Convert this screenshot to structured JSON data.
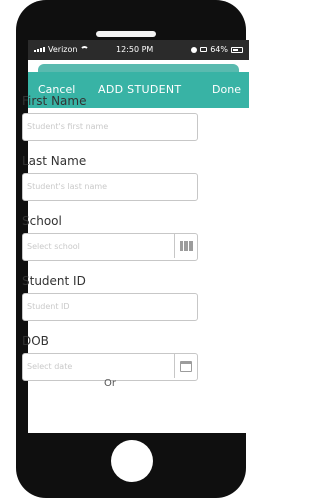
{
  "status": {
    "carrier": "Verizon",
    "time": "12:50 PM",
    "battery": "64%",
    "battery_level": 0.64
  },
  "nav": {
    "cancel": "Cancel",
    "title": "ADD STUDENT",
    "done": "Done"
  },
  "form": {
    "first_name": {
      "label": "First Name",
      "placeholder": "Student's first name",
      "value": ""
    },
    "last_name": {
      "label": "Last Name",
      "placeholder": "Student's last name",
      "value": ""
    },
    "school": {
      "label": "School",
      "placeholder": "Select school",
      "value": "",
      "icon": "map-icon"
    },
    "student_id": {
      "label": "Student ID",
      "placeholder": "Student ID",
      "value": ""
    },
    "dob": {
      "label": "DOB",
      "placeholder": "Select date",
      "value": "",
      "icon": "calendar-icon"
    }
  },
  "or": "Or",
  "colors": {
    "accent": "#38b3a5",
    "frame": "#0f0f0f"
  }
}
